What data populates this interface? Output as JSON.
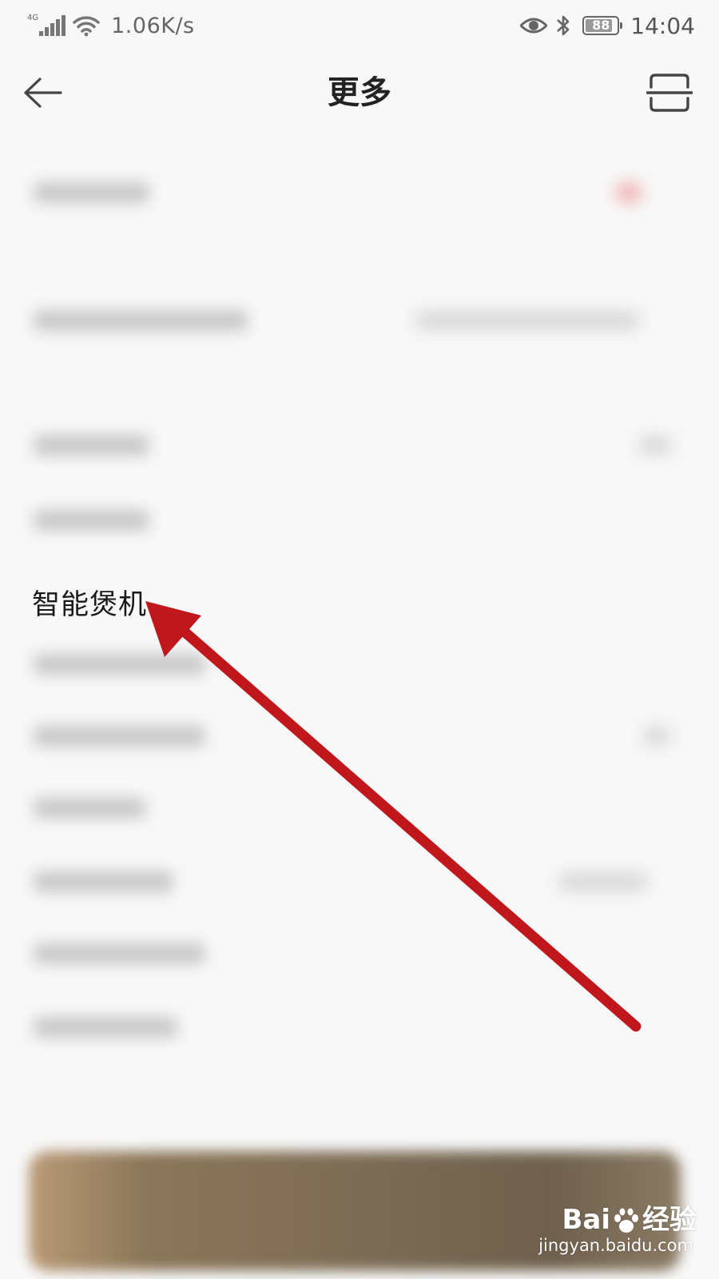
{
  "status_bar": {
    "network_type": "4G",
    "net_speed": "1.06K/s",
    "battery_level": "88",
    "battery_percent": 88,
    "time": "14:04",
    "icons": [
      "signal-icon",
      "wifi-icon",
      "eye-icon",
      "bluetooth-icon",
      "battery-icon"
    ]
  },
  "header": {
    "title": "更多",
    "back_icon": "arrow-left-icon",
    "scan_icon": "scan-icon"
  },
  "list": {
    "highlighted_item": {
      "label": "智能煲机"
    }
  },
  "annotation": {
    "color": "#c0171c",
    "icon": "red-arrow-icon"
  },
  "watermark": {
    "brand": "Bai",
    "brand_suffix": "经验",
    "url": "jingyan.baidu.com"
  }
}
